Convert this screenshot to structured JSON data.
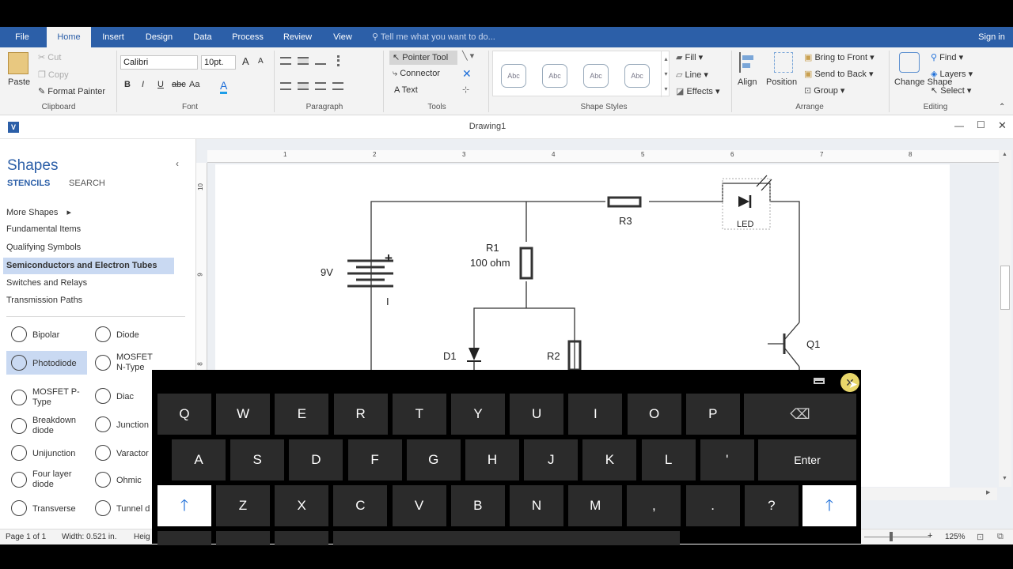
{
  "menu": {
    "tabs": [
      "File",
      "Home",
      "Insert",
      "Design",
      "Data",
      "Process",
      "Review",
      "View"
    ],
    "tell_me": "Tell me what you want to do...",
    "sign_in": "Sign in"
  },
  "ribbon": {
    "clipboard": {
      "paste": "Paste",
      "cut": "Cut",
      "copy": "Copy",
      "format_painter": "Format Painter",
      "label": "Clipboard"
    },
    "font": {
      "family": "Calibri",
      "size": "10pt.",
      "label": "Font",
      "bold": "B",
      "italic": "I",
      "underline": "U",
      "strike": "abc",
      "case": "Aa",
      "grow": "A",
      "shrink": "A"
    },
    "paragraph": {
      "label": "Paragraph"
    },
    "tools": {
      "pointer": "Pointer Tool",
      "connector": "Connector",
      "text": "Text",
      "label": "Tools"
    },
    "shape_styles": {
      "swatch": "Abc",
      "fill": "Fill",
      "line": "Line",
      "effects": "Effects",
      "label": "Shape Styles"
    },
    "arrange": {
      "align": "Align",
      "position": "Position",
      "bring_front": "Bring to Front",
      "send_back": "Send to Back",
      "group": "Group",
      "label": "Arrange"
    },
    "editing": {
      "change_shape": "Change Shape",
      "find": "Find",
      "layers": "Layers",
      "select": "Select",
      "label": "Editing"
    }
  },
  "document": {
    "title": "Drawing1"
  },
  "shapes_panel": {
    "title": "Shapes",
    "tabs": [
      "STENCILS",
      "SEARCH"
    ],
    "more_shapes": "More Shapes",
    "stencils": [
      "Fundamental Items",
      "Qualifying Symbols",
      "Semiconductors and Electron Tubes",
      "Switches and Relays",
      "Transmission Paths"
    ],
    "items": [
      "Bipolar",
      "Diode",
      "Photodiode",
      "MOSFET N-Type",
      "MOSFET P-Type",
      "Diac",
      "Breakdown diode",
      "Junction",
      "Unijunction",
      "Varactor",
      "Four layer diode",
      "Ohmic",
      "Transverse",
      "Tunnel d"
    ]
  },
  "ruler": {
    "top": [
      "1",
      "2",
      "3",
      "4",
      "5",
      "6",
      "7",
      "8"
    ],
    "left": [
      "10",
      "9",
      "8"
    ]
  },
  "drawing": {
    "battery": "9V",
    "r1": "R1",
    "r1_value": "100 ohm",
    "r3": "R3",
    "led": "LED",
    "d1": "D1",
    "r2": "R2",
    "q1": "Q1",
    "plus": "+",
    "minus": "I"
  },
  "status": {
    "page": "Page 1 of 1",
    "width": "Width: 0.521 in.",
    "height": "Heig",
    "zoom": "125%"
  },
  "keyboard": {
    "row1": [
      "Q",
      "W",
      "E",
      "R",
      "T",
      "Y",
      "U",
      "I",
      "O",
      "P"
    ],
    "row2": [
      "A",
      "S",
      "D",
      "F",
      "G",
      "H",
      "J",
      "K",
      "L",
      "'"
    ],
    "row3": [
      "Z",
      "X",
      "C",
      "V",
      "B",
      "N",
      "M",
      ",",
      ".",
      "?"
    ],
    "enter": "Enter",
    "backspace": "⌫",
    "shift": "🡑"
  }
}
